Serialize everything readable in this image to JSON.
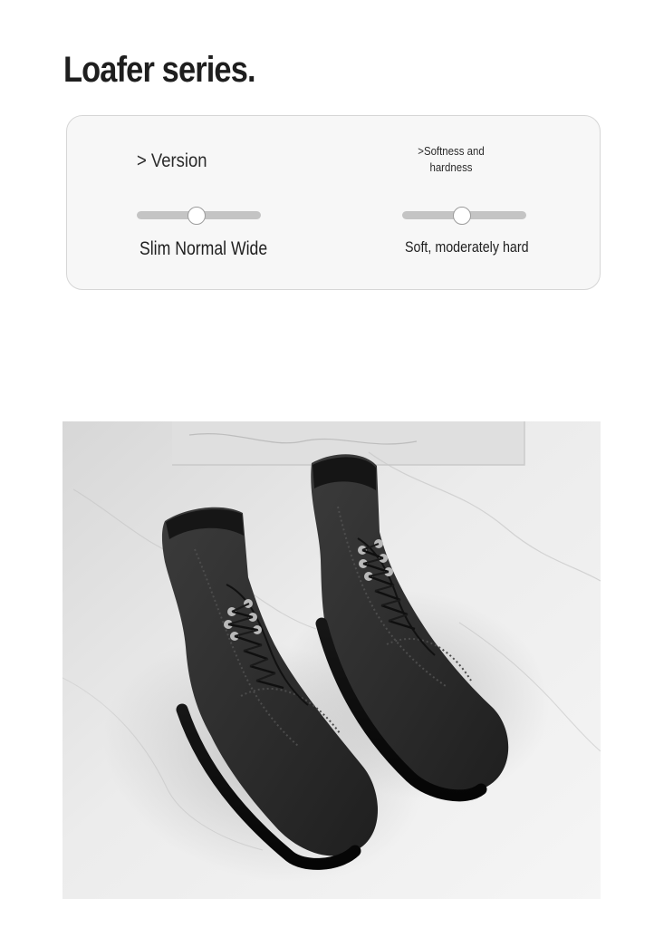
{
  "page": {
    "title": "Loafer series."
  },
  "spec_card": {
    "version": {
      "heading": "> Version",
      "slider_position": 0.48,
      "caption": "Slim Normal Wide"
    },
    "softness": {
      "heading": ">Softness and hardness",
      "slider_position": 0.48,
      "caption": "Soft, moderately hard"
    }
  },
  "product_photo": {
    "icon": "dark-suede-lace-up-boots-photo",
    "colors": {
      "background": "#e9e9e9",
      "boot": "#2f3030",
      "eyelet": "#b9b9b9"
    }
  }
}
